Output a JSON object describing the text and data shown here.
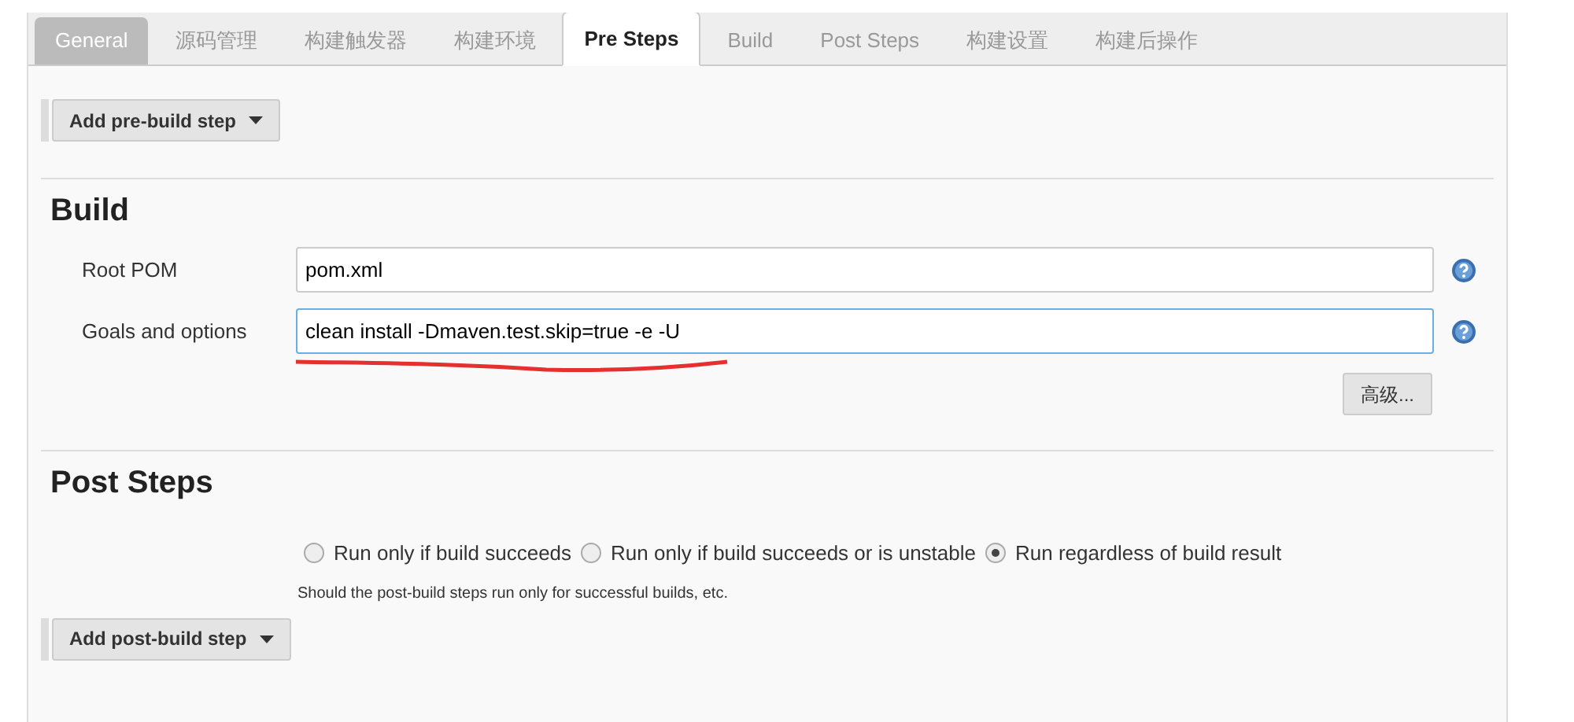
{
  "tabs": [
    {
      "label": "General",
      "selected": false,
      "disabled": true
    },
    {
      "label": "源码管理",
      "selected": false,
      "disabled": false
    },
    {
      "label": "构建触发器",
      "selected": false,
      "disabled": false
    },
    {
      "label": "构建环境",
      "selected": false,
      "disabled": false
    },
    {
      "label": "Pre Steps",
      "selected": true,
      "disabled": false
    },
    {
      "label": "Build",
      "selected": false,
      "disabled": false
    },
    {
      "label": "Post Steps",
      "selected": false,
      "disabled": false
    },
    {
      "label": "构建设置",
      "selected": false,
      "disabled": false
    },
    {
      "label": "构建后操作",
      "selected": false,
      "disabled": false
    }
  ],
  "pre_steps": {
    "button": "Add pre-build step"
  },
  "build": {
    "title": "Build",
    "fields": [
      {
        "label": "Root POM",
        "value": "pom.xml",
        "focused": false,
        "underlined": false
      },
      {
        "label": "Goals and options",
        "value": "clean install -Dmaven.test.skip=true -e -U",
        "focused": true,
        "underlined": true
      }
    ],
    "advanced_button": "高级..."
  },
  "post_steps": {
    "title": "Post Steps",
    "options": [
      {
        "label": "Run only if build succeeds",
        "selected": false
      },
      {
        "label": "Run only if build succeeds or is unstable",
        "selected": false
      },
      {
        "label": "Run regardless of build result",
        "selected": true
      }
    ],
    "hint": "Should the post-build steps run only for successful builds, etc.",
    "button": "Add post-build step"
  }
}
